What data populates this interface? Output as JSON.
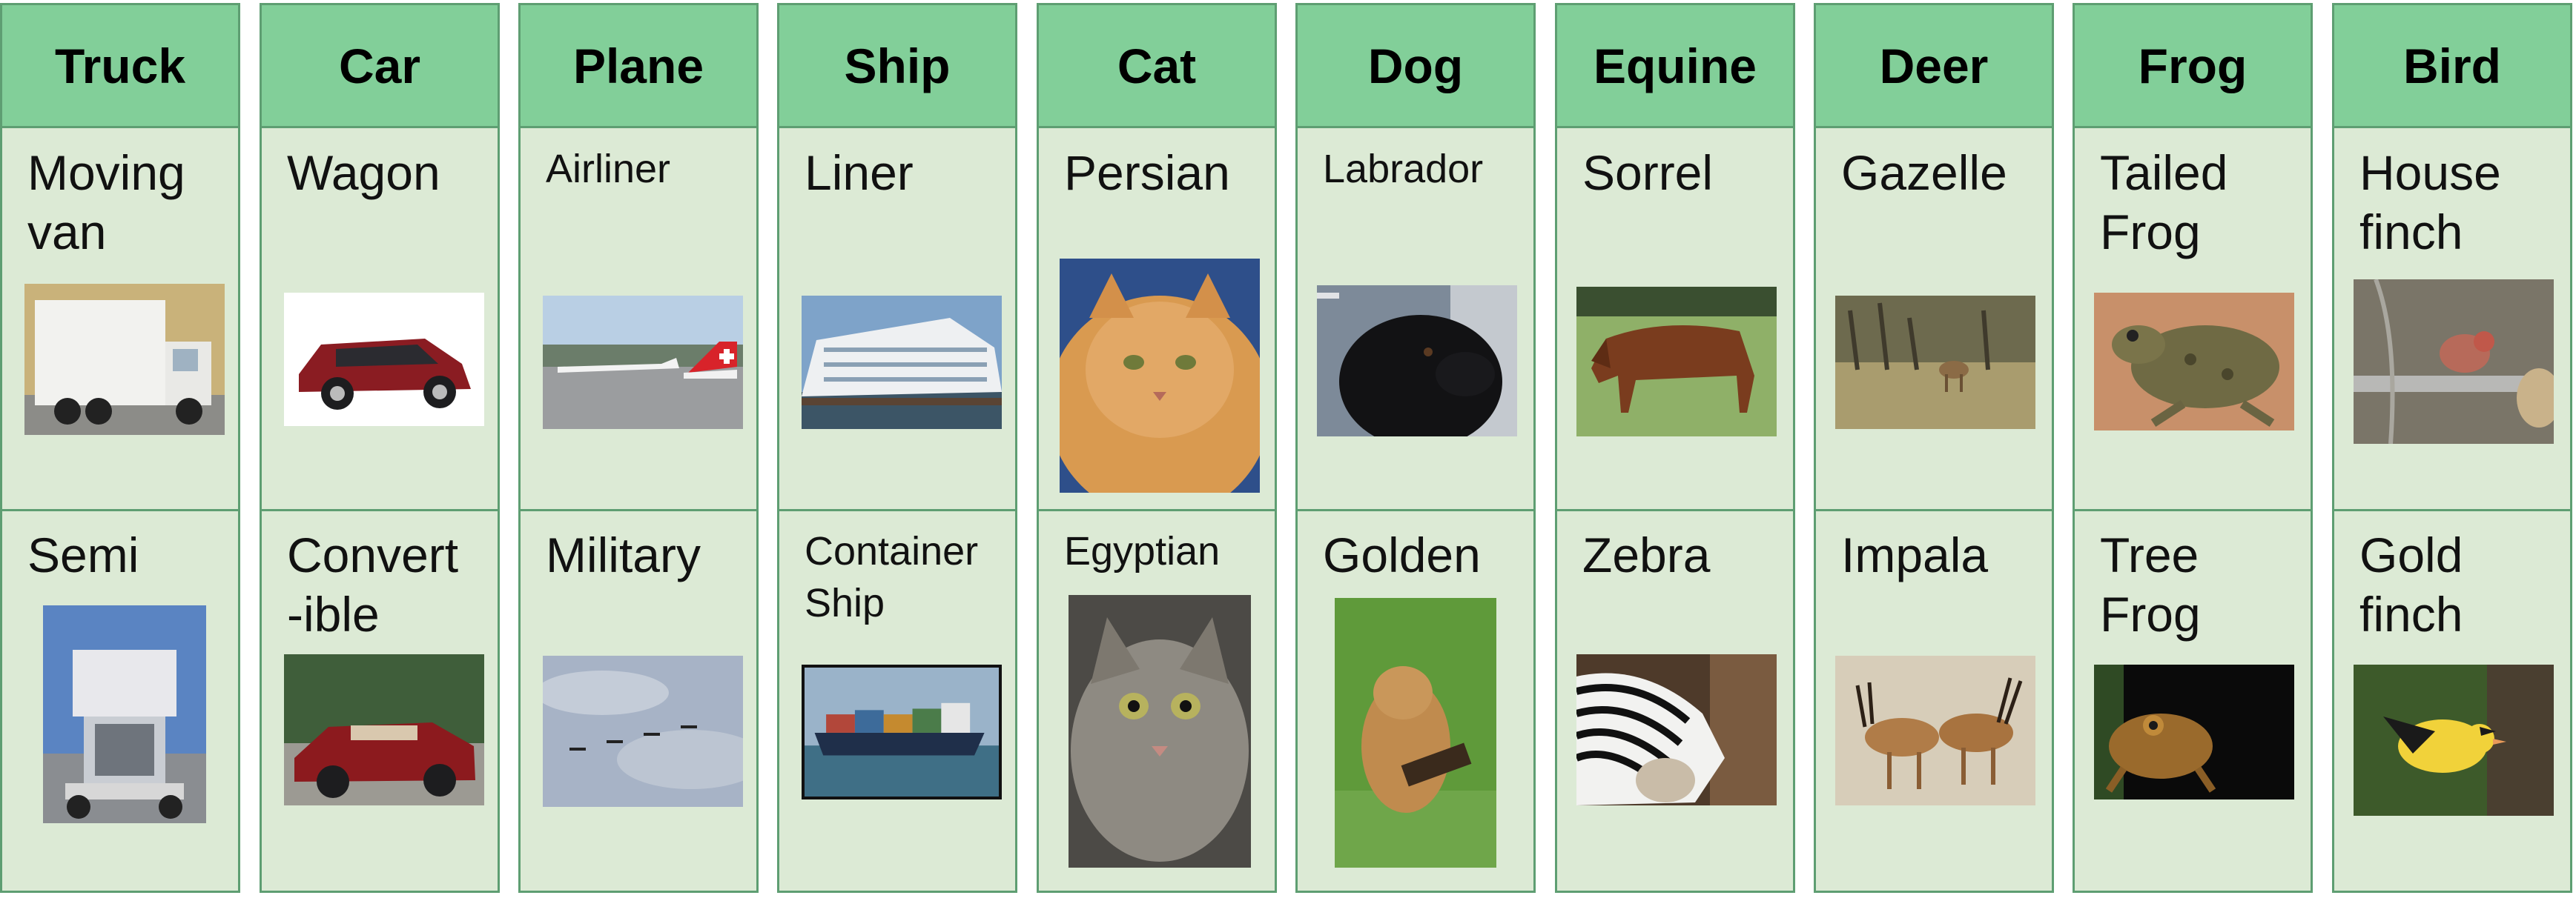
{
  "columns": [
    {
      "category": "Truck",
      "top": {
        "label": "Moving\nvan",
        "image": "moving-van-photo"
      },
      "bottom": {
        "label": "Semi",
        "image": "semi-truck-photo"
      }
    },
    {
      "category": "Car",
      "top": {
        "label": "Wagon",
        "image": "wagon-photo"
      },
      "bottom": {
        "label": "Convert\n-ible",
        "image": "convertible-photo"
      }
    },
    {
      "category": "Plane",
      "top": {
        "label": "Airliner",
        "image": "airliner-photo"
      },
      "bottom": {
        "label": "Military",
        "image": "military-planes-photo"
      }
    },
    {
      "category": "Ship",
      "top": {
        "label": "Liner",
        "image": "liner-photo"
      },
      "bottom": {
        "label": "Container\nShip",
        "image": "container-ship-photo"
      }
    },
    {
      "category": "Cat",
      "top": {
        "label": "Persian",
        "image": "persian-cat-photo"
      },
      "bottom": {
        "label": "Egyptian",
        "image": "egyptian-cat-photo"
      }
    },
    {
      "category": "Dog",
      "top": {
        "label": "Labrador",
        "image": "labrador-photo"
      },
      "bottom": {
        "label": "Golden",
        "image": "golden-retriever-photo"
      }
    },
    {
      "category": "Equine",
      "top": {
        "label": "Sorrel",
        "image": "sorrel-horse-photo"
      },
      "bottom": {
        "label": "Zebra",
        "image": "zebra-photo"
      }
    },
    {
      "category": "Deer",
      "top": {
        "label": "Gazelle",
        "image": "gazelle-photo"
      },
      "bottom": {
        "label": "Impala",
        "image": "impala-photo"
      }
    },
    {
      "category": "Frog",
      "top": {
        "label": "Tailed\nFrog",
        "image": "tailed-frog-photo"
      },
      "bottom": {
        "label": "Tree\nFrog",
        "image": "tree-frog-photo"
      }
    },
    {
      "category": "Bird",
      "top": {
        "label": "House\nfinch",
        "image": "house-finch-photo"
      },
      "bottom": {
        "label": "Gold\nfinch",
        "image": "goldfinch-photo"
      }
    }
  ],
  "colors": {
    "header": "#82cf99",
    "body": "#dcead5",
    "border": "#5e9e72"
  }
}
